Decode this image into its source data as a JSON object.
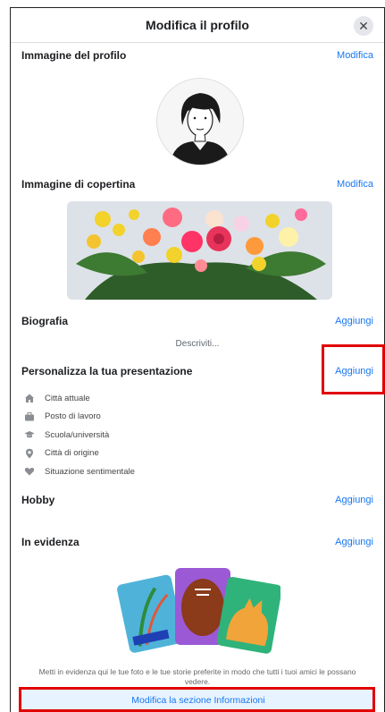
{
  "header": {
    "title": "Modifica il profilo",
    "close_glyph": "✕"
  },
  "profile_picture": {
    "title": "Immagine del profilo",
    "action": "Modifica"
  },
  "cover_photo": {
    "title": "Immagine di copertina",
    "action": "Modifica"
  },
  "bio": {
    "title": "Biografia",
    "action": "Aggiungi",
    "placeholder": "Descriviti..."
  },
  "intro": {
    "title": "Personalizza la tua presentazione",
    "action": "Aggiungi",
    "items": [
      {
        "icon": "house-icon",
        "label": "Città attuale"
      },
      {
        "icon": "briefcase-icon",
        "label": "Posto di lavoro"
      },
      {
        "icon": "graduation-cap-icon",
        "label": "Scuola/università"
      },
      {
        "icon": "location-pin-icon",
        "label": "Città di origine"
      },
      {
        "icon": "heart-icon",
        "label": "Situazione sentimentale"
      }
    ]
  },
  "hobby": {
    "title": "Hobby",
    "action": "Aggiungi"
  },
  "featured": {
    "title": "In evidenza",
    "action": "Aggiungi",
    "description": "Metti in evidenza qui le tue foto e le tue storie preferite in modo che tutti i tuoi amici le possano vedere."
  },
  "about_button": {
    "label": "Modifica la sezione Informazioni"
  },
  "colors": {
    "link": "#1877f2",
    "highlight": "#e00000",
    "button_bg": "#e7f3ff"
  }
}
